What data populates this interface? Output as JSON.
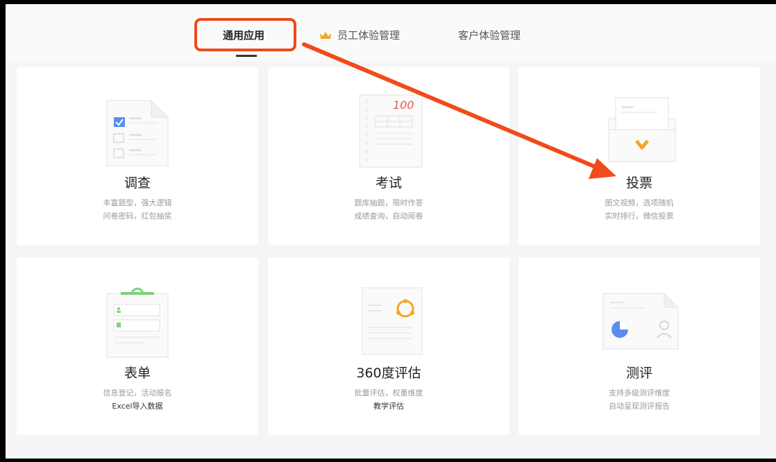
{
  "tabs": {
    "general": "通用应用",
    "employee": "员工体验管理",
    "customer": "客户体验管理"
  },
  "cards": [
    {
      "title": "调查",
      "desc1": "丰富题型，强大逻辑",
      "desc2": "问卷密码，红包抽奖"
    },
    {
      "title": "考试",
      "desc1": "题库抽题，限时作答",
      "desc2": "成绩查询，自动阅卷",
      "score": "100"
    },
    {
      "title": "投票",
      "desc1": "图文视频，选项随机",
      "desc2": "实时排行，微信投票"
    },
    {
      "title": "表单",
      "desc1": "信息登记，活动报名",
      "desc2": "Excel导入数据"
    },
    {
      "title": "360度评估",
      "desc1": "批量评估，权重维度",
      "desc2": "教学评估"
    },
    {
      "title": "测评",
      "desc1": "支持多级测评维度",
      "desc2": "自动呈现测评报告"
    }
  ],
  "colors": {
    "highlight": "#ec4b1b",
    "arrow": "#f24a1a",
    "crown": "#f5a623",
    "check": "#5b8def"
  }
}
